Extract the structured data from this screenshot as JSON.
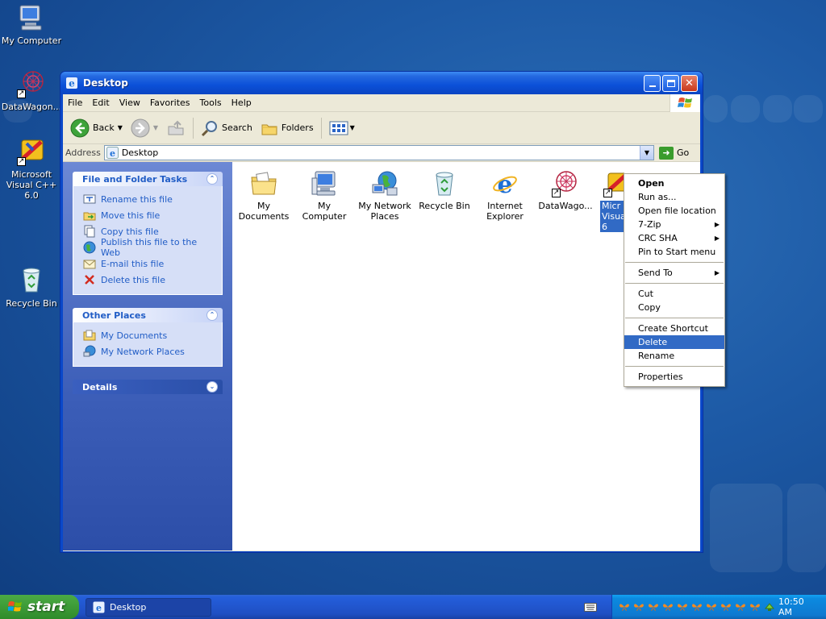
{
  "desktop": {
    "icons": [
      {
        "label": "My Computer"
      },
      {
        "label": "DataWagon..."
      },
      {
        "label": "Microsoft Visual C++ 6.0"
      },
      {
        "label": "Recycle Bin"
      }
    ]
  },
  "window": {
    "title": "Desktop",
    "menu": [
      "File",
      "Edit",
      "View",
      "Favorites",
      "Tools",
      "Help"
    ],
    "toolbar": {
      "back": "Back",
      "search": "Search",
      "folders": "Folders"
    },
    "address": {
      "label": "Address",
      "value": "Desktop",
      "go": "Go"
    },
    "taskpane": {
      "file_tasks": {
        "title": "File and Folder Tasks",
        "items": [
          "Rename this file",
          "Move this file",
          "Copy this file",
          "Publish this file to the Web",
          "E-mail this file",
          "Delete this file"
        ]
      },
      "other_places": {
        "title": "Other Places",
        "items": [
          "My Documents",
          "My Network Places"
        ]
      },
      "details": {
        "title": "Details"
      }
    },
    "files": [
      {
        "label": "My Documents"
      },
      {
        "label": "My Computer"
      },
      {
        "label": "My Network Places"
      },
      {
        "label": "Recycle Bin"
      },
      {
        "label": "Internet Explorer"
      },
      {
        "label": "DataWago..."
      },
      {
        "label": "Micr Visua 6"
      }
    ]
  },
  "context_menu": {
    "items": [
      "Open",
      "Run as...",
      "Open file location",
      "7-Zip",
      "CRC SHA",
      "Pin to Start menu",
      "Send To",
      "Cut",
      "Copy",
      "Create Shortcut",
      "Delete",
      "Rename",
      "Properties"
    ],
    "active": "Delete"
  },
  "taskbar": {
    "start": "start",
    "task": "Desktop",
    "clock": "10:50 AM"
  },
  "colors": {
    "desktop": "#1d5aa6",
    "titlebar": "#0b50d8",
    "selection": "#316ac5",
    "taskpane_link": "#215dc6",
    "start_green": "#3c9a35"
  }
}
